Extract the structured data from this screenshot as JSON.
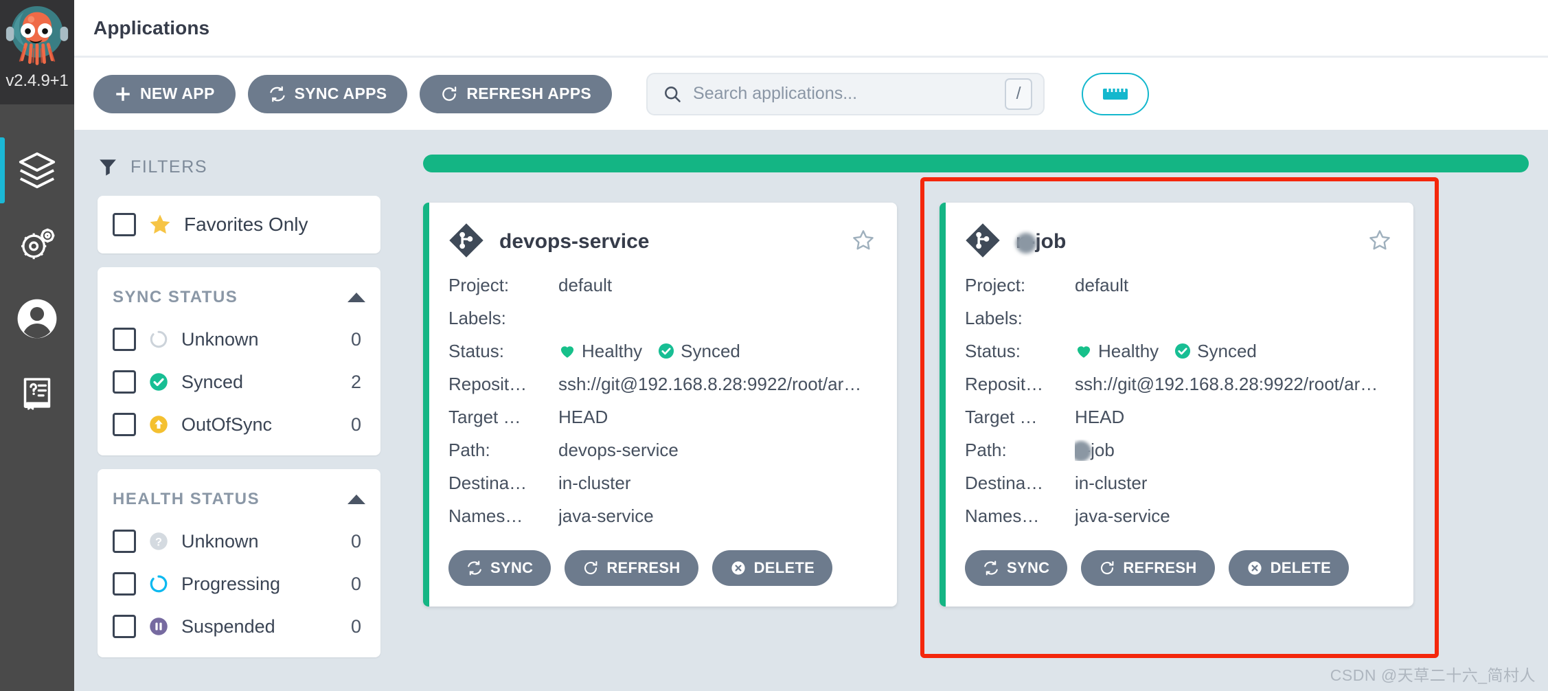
{
  "sidebar": {
    "version": "v2.4.9+1",
    "logo_icon": "argo-octopus-logo",
    "items": [
      {
        "icon": "layers-icon",
        "name": "applications",
        "active": true
      },
      {
        "icon": "gears-settings-icon",
        "name": "settings",
        "active": false
      },
      {
        "icon": "user-avatar-icon",
        "name": "user-info",
        "active": false
      },
      {
        "icon": "documentation-book-icon",
        "name": "documentation",
        "active": false
      }
    ]
  },
  "header": {
    "title": "Applications"
  },
  "toolbar": {
    "new_app_label": "NEW APP",
    "sync_apps_label": "SYNC APPS",
    "refresh_apps_label": "REFRESH APPS",
    "search_placeholder": "Search applications...",
    "search_value": "",
    "search_shortcut": "/",
    "view_toggle_icon": "ruler-icon",
    "accent_color": "#13b7cd"
  },
  "filters": {
    "title": "FILTERS",
    "favorites_only": {
      "label": "Favorites Only",
      "checked": false,
      "icon": "star-filled-icon"
    },
    "sections": [
      {
        "title": "SYNC STATUS",
        "collapsed": false,
        "items": [
          {
            "label": "Unknown",
            "count": "0",
            "icon": "circle-outline-gray-icon",
            "color": "#ccd3da",
            "checked": false
          },
          {
            "label": "Synced",
            "count": "2",
            "icon": "check-circle-green-icon",
            "color": "#18be94",
            "checked": false
          },
          {
            "label": "OutOfSync",
            "count": "0",
            "icon": "arrow-up-circle-yellow-icon",
            "color": "#f4c030",
            "checked": false
          }
        ]
      },
      {
        "title": "HEALTH STATUS",
        "collapsed": false,
        "items": [
          {
            "label": "Unknown",
            "count": "0",
            "icon": "question-circle-gray-icon",
            "color": "#ccd3da",
            "checked": false
          },
          {
            "label": "Progressing",
            "count": "0",
            "icon": "spinner-blue-icon",
            "color": "#0db9f0",
            "checked": false
          },
          {
            "label": "Suspended",
            "count": "0",
            "icon": "pause-circle-purple-icon",
            "color": "#766aa0",
            "checked": false
          }
        ]
      }
    ]
  },
  "main": {
    "progress_bar_color": "#14b584",
    "field_labels": {
      "project": "Project:",
      "labels": "Labels:",
      "status": "Status:",
      "repository": "Reposit…",
      "target": "Target …",
      "path": "Path:",
      "destination": "Destina…",
      "namespace": "Names…"
    },
    "action_labels": {
      "sync": "SYNC",
      "refresh": "REFRESH",
      "delete": "DELETE"
    },
    "cards": [
      {
        "name": "devops-service",
        "name_redacted": false,
        "favorite": false,
        "project": "default",
        "labels": "",
        "health": "Healthy",
        "sync": "Synced",
        "repository": "ssh://git@192.168.8.28:9922/root/ar…",
        "target_revision": "HEAD",
        "path": "devops-service",
        "path_redacted": false,
        "destination": "in-cluster",
        "namespace": "java-service"
      },
      {
        "name": "n-job",
        "name_redacted": true,
        "favorite": false,
        "project": "default",
        "labels": "",
        "health": "Healthy",
        "sync": "Synced",
        "repository": "ssh://git@192.168.8.28:9922/root/ar…",
        "target_revision": "HEAD",
        "path": "n-job",
        "path_redacted": true,
        "destination": "in-cluster",
        "namespace": "java-service"
      }
    ]
  },
  "annotation": {
    "color": "#f4270c",
    "shape": "rectangle-highlight"
  },
  "watermark": {
    "text": "CSDN @天草二十六_简村人"
  }
}
